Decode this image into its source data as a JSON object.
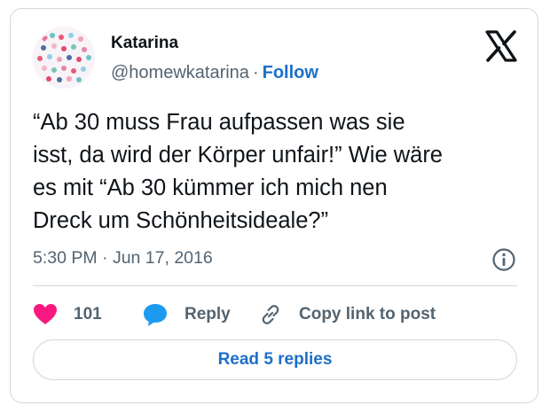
{
  "author": {
    "name": "Katarina",
    "handle": "@homewkatarina",
    "separator": "·",
    "follow_label": "Follow"
  },
  "tweet": {
    "text": "“Ab 30 muss Frau aufpassen was sie\nisst, da wird der Körper unfair!” Wie wäre\nes mit “Ab 30 kümmer ich mich nen\nDreck um Schönheitsideale?”",
    "timestamp": "5:30 PM · Jun 17, 2016"
  },
  "actions": {
    "likes_count": "101",
    "reply_label": "Reply",
    "copy_link_label": "Copy link to post"
  },
  "footer": {
    "read_replies_label": "Read 5 replies"
  },
  "colors": {
    "like_pink": "#f91880",
    "reply_blue": "#1d9bf0",
    "link_blue": "#1d6fc8",
    "muted_text": "#536471",
    "border": "#cfd9de"
  },
  "icons": {
    "brand": "x-logo-icon",
    "info": "info-icon",
    "like": "heart-icon",
    "reply": "speech-bubble-icon",
    "copy": "link-icon"
  }
}
